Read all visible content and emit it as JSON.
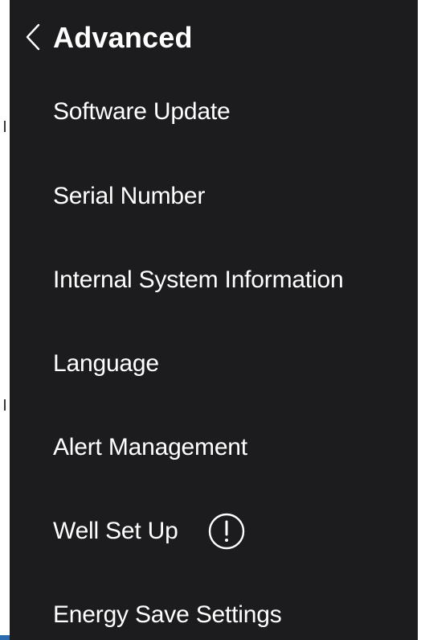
{
  "header": {
    "title": "Advanced",
    "back_icon": "chevron-left-icon"
  },
  "menu": {
    "items": [
      {
        "label": "Software Update"
      },
      {
        "label": "Serial Number"
      },
      {
        "label": "Internal System Information"
      },
      {
        "label": "Language"
      },
      {
        "label": "Alert Management"
      },
      {
        "label": "Well Set Up",
        "badge_icon": "alert-circle-icon"
      },
      {
        "label": "Energy Save Settings"
      }
    ]
  },
  "colors": {
    "background": "#1c1c1e",
    "text": "#ffffff",
    "accent": "#2b6cb0"
  }
}
